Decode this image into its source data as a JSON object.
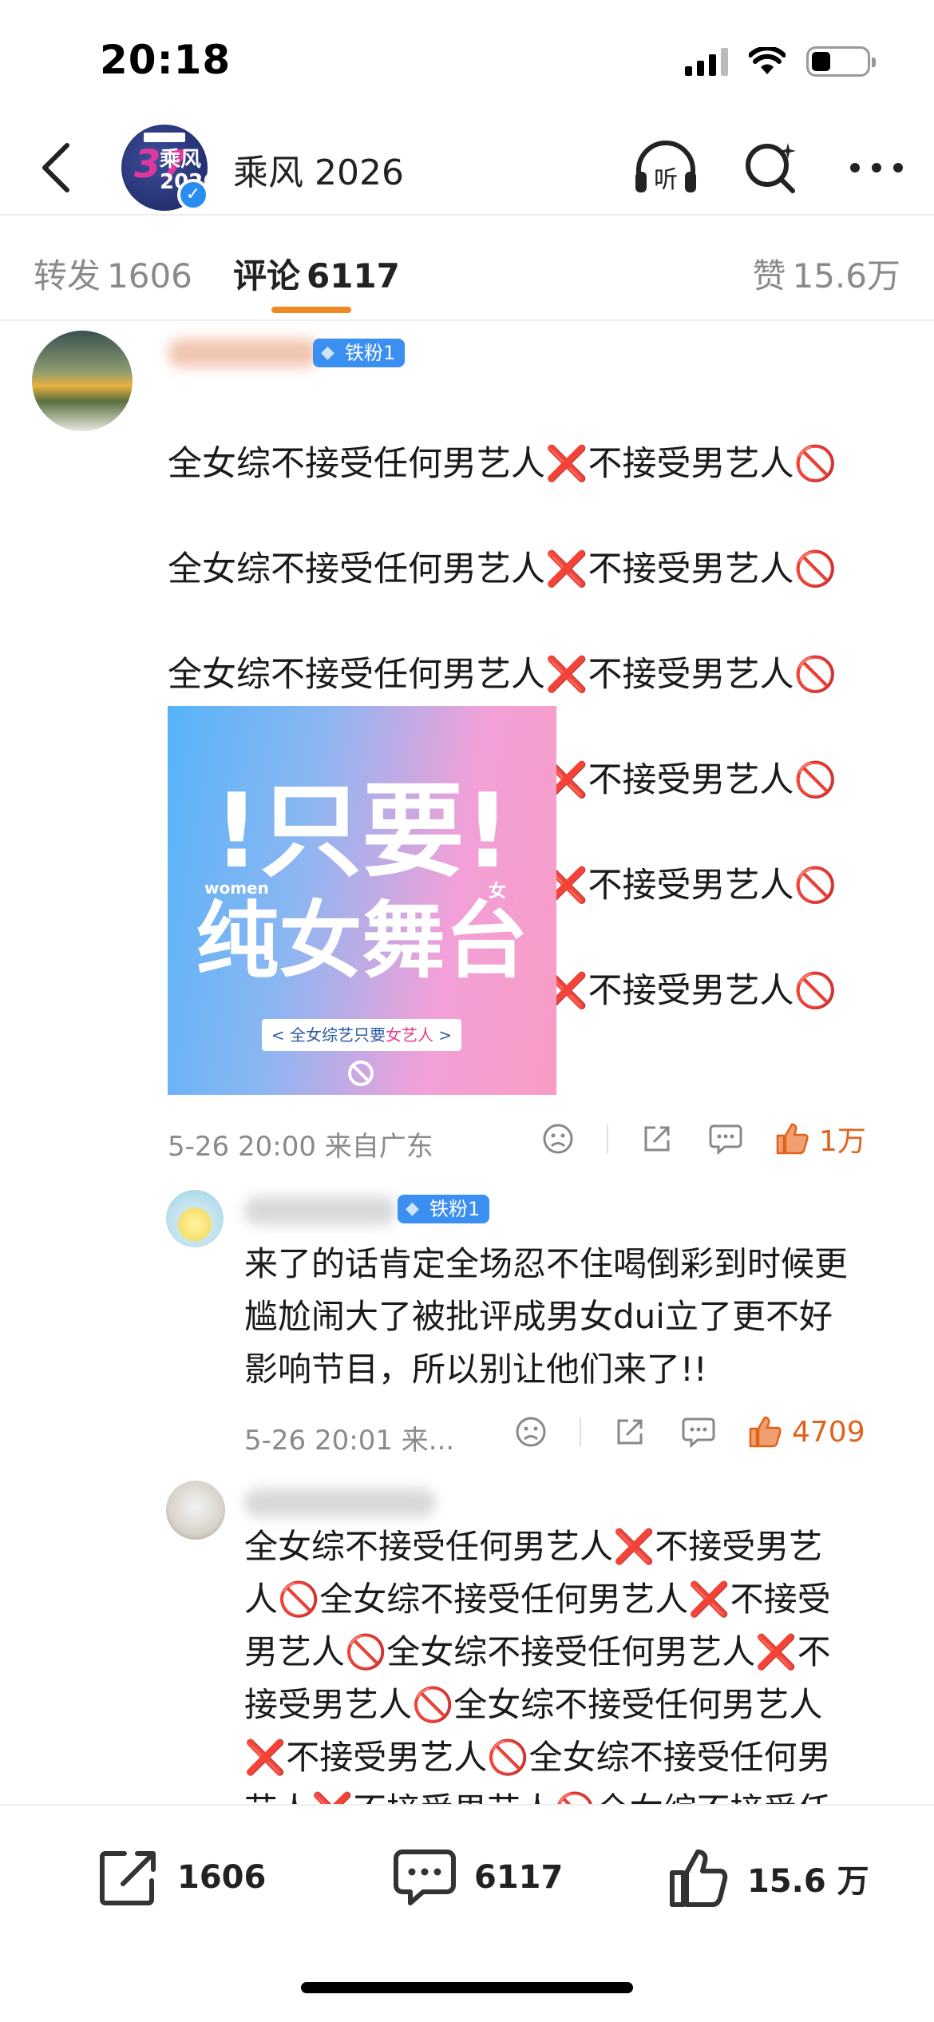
{
  "status_bar": {
    "time": "20:18",
    "battery_fraction": 0.35
  },
  "nav": {
    "channel_name": "乘风 2026",
    "avatar_text": "乘风\n2026",
    "listen_label": "听"
  },
  "tabs": [
    {
      "label": "转发",
      "count": "1606"
    },
    {
      "label": "评论",
      "count": "6117"
    },
    {
      "label": "赞",
      "count": "15.6万"
    }
  ],
  "comments": [
    {
      "fan_badge": "铁粉1",
      "lines": [
        "全女综不接受任何男艺人❌不接受男艺人🚫",
        "全女综不接受任何男艺人❌不接受男艺人🚫",
        "全女综不接受任何男艺人❌不接受男艺人🚫",
        "全女综不接受任何男艺人❌不接受男艺人🚫",
        "全女综不接受任何男艺人❌不接受男艺人🚫",
        "全女综不接受任何男艺人❌不接受男艺人🚫"
      ],
      "image": {
        "line1": "!只要!",
        "line2": "纯女舞台",
        "tag_en": "women",
        "tag_zh": "女",
        "ribbon_pre": "< 全女综艺只要",
        "ribbon_hl": "女艺人",
        "ribbon_post": " >"
      },
      "meta": "5-26 20:00  来自广东",
      "likes": "1万"
    },
    {
      "fan_badge": "铁粉1",
      "text": "来了的话肯定全场忍不住喝倒彩到时候更\n尴尬闹大了被批评成男女dui立了更不好\n影响节目，所以别让他们来了!!",
      "meta": "5-26 20:01  来...",
      "likes": "4709"
    },
    {
      "text": "全女综不接受任何男艺人❌不接受男艺\n人🚫全女综不接受任何男艺人❌不接受\n男艺人🚫全女综不接受任何男艺人❌不\n接受男艺人🚫全女综不接受任何男艺人\n❌不接受男艺人🚫全女综不接受任何男\n艺人❌不接受男艺人🚫全女综不接受任"
    }
  ],
  "bottom_bar": {
    "reposts": "1606",
    "comments": "6117",
    "likes": "15.6 万"
  },
  "colors": {
    "accent": "#f08a24",
    "like": "#e2621b",
    "badge": "#3a8ff0",
    "verified": "#2a8cf0"
  }
}
